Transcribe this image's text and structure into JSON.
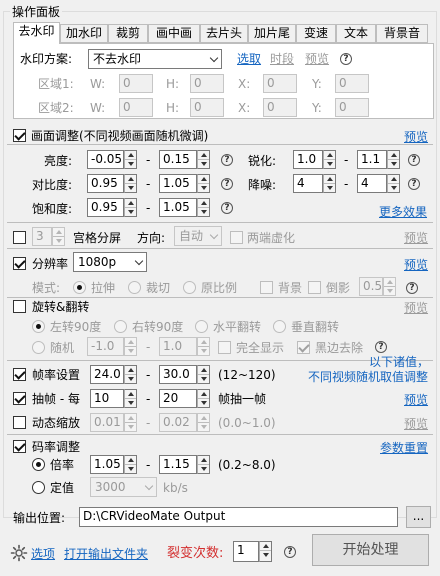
{
  "panel_title": "操作面板",
  "tabs": [
    "去水印",
    "加水印",
    "裁剪",
    "画中画",
    "去片头",
    "加片尾",
    "变速",
    "文本",
    "背景音"
  ],
  "watermark": {
    "scheme_label": "水印方案:",
    "scheme_value": "不去水印",
    "select_link": "选取",
    "timeseg_link": "时段",
    "preview_link": "预览",
    "region1_label": "区域1:",
    "region2_label": "区域2:",
    "w_label": "W:",
    "h_label": "H:",
    "x_label": "X:",
    "y_label": "Y:",
    "zero": "0"
  },
  "picture_adjust": {
    "label": "画面调整(不同视频画面随机微调)",
    "preview": "预览",
    "brightness_label": "亮度:",
    "brightness_min": "-0.05",
    "brightness_max": "0.15",
    "sharpen_label": "锐化:",
    "sharpen_min": "1.0",
    "sharpen_max": "1.1",
    "contrast_label": "对比度:",
    "contrast_min": "0.95",
    "contrast_max": "1.05",
    "denoise_label": "降噪:",
    "denoise_min": "4",
    "denoise_max": "4",
    "saturation_label": "饱和度:",
    "saturation_min": "0.95",
    "saturation_max": "1.05",
    "more_effects": "更多效果",
    "dash": "-"
  },
  "grid_split": {
    "count": "3",
    "label": "宫格分屏",
    "direction_label": "方向:",
    "direction_value": "自动",
    "blur_label": "两端虚化",
    "preview": "预览"
  },
  "resolution": {
    "label": "分辨率",
    "value": "1080p",
    "preview": "预览",
    "mode_label": "模式:",
    "stretch": "拉伸",
    "crop": "裁切",
    "original_ratio": "原比例",
    "background": "背景",
    "reflection": "倒影",
    "reflection_value": "0.5"
  },
  "rotate": {
    "label": "旋转&翻转",
    "preview": "预览",
    "left90": "左转90度",
    "right90": "右转90度",
    "hflip": "水平翻转",
    "vflip": "垂直翻转",
    "random": "随机",
    "rand_min": "-1.0",
    "rand_max": "1.0",
    "full_display": "完全显示",
    "remove_black": "黑边去除"
  },
  "note_line1": "以下诸值，",
  "note_line2": "不同视频随机取值调整",
  "framerate": {
    "label": "帧率设置",
    "min": "24.0",
    "max": "30.0",
    "range": "(12~120)"
  },
  "frame_drop": {
    "label": "抽帧 - 每",
    "min": "10",
    "max": "20",
    "suffix": "帧抽一帧",
    "preview": "预览"
  },
  "dynamic_zoom": {
    "label": "动态缩放",
    "min": "0.01",
    "max": "0.02",
    "range": "(0.0~1.0)",
    "preview": "预览"
  },
  "bitrate": {
    "label": "码率调整",
    "reset": "参数重置",
    "multiplier_label": "倍率",
    "mult_min": "1.05",
    "mult_max": "1.15",
    "mult_range": "(0.2~8.0)",
    "fixed_label": "定值",
    "fixed_value": "3000",
    "unit": "kb/s"
  },
  "output": {
    "label": "输出位置:",
    "path": "D:\\CRVideoMate Output",
    "browse": "...",
    "options": "选项",
    "open_folder": "打开输出文件夹",
    "split_label": "裂变次数:",
    "split_value": "1",
    "start": "开始处理"
  },
  "colors": {
    "link": "#1565c0",
    "red": "#d32f2f",
    "panel": "#f0f0f0"
  }
}
